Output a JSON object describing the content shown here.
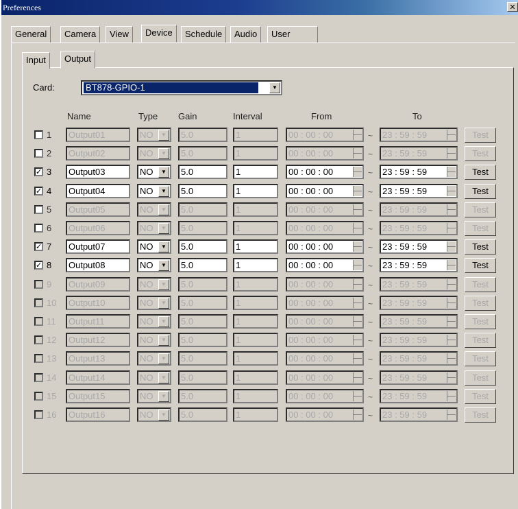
{
  "window": {
    "title": "Preferences",
    "close_glyph": "✕"
  },
  "tabs": [
    "General",
    "Camera",
    "View",
    "Device",
    "Schedule",
    "Audio",
    "User"
  ],
  "active_tab": "Device",
  "subtabs": [
    "Input",
    "Output"
  ],
  "active_subtab": "Output",
  "card": {
    "label": "Card:",
    "value": "BT878-GPIO-1"
  },
  "headers": {
    "name": "Name",
    "type": "Type",
    "gain": "Gain",
    "interval": "Interval",
    "from": "From",
    "to": "To"
  },
  "separator": "~",
  "check_glyph": "✓",
  "dropdown_icon": "▼",
  "rows": [
    {
      "num": "1",
      "checked": false,
      "enabled": false,
      "name": "Output01",
      "type": "NO",
      "gain": "5.0",
      "interval": "1",
      "from": "00 : 00 : 00",
      "to": "23 : 59 : 59",
      "test": "Test",
      "grey_num": false
    },
    {
      "num": "2",
      "checked": false,
      "enabled": false,
      "name": "Output02",
      "type": "NO",
      "gain": "5.0",
      "interval": "1",
      "from": "00 : 00 : 00",
      "to": "23 : 59 : 59",
      "test": "Test",
      "grey_num": false
    },
    {
      "num": "3",
      "checked": true,
      "enabled": true,
      "name": "Output03",
      "type": "NO",
      "gain": "5.0",
      "interval": "1",
      "from": "00 : 00 : 00",
      "to": "23 : 59 : 59",
      "test": "Test",
      "grey_num": false
    },
    {
      "num": "4",
      "checked": true,
      "enabled": true,
      "name": "Output04",
      "type": "NO",
      "gain": "5.0",
      "interval": "1",
      "from": "00 : 00 : 00",
      "to": "23 : 59 : 59",
      "test": "Test",
      "grey_num": false
    },
    {
      "num": "5",
      "checked": false,
      "enabled": false,
      "name": "Output05",
      "type": "NO",
      "gain": "5.0",
      "interval": "1",
      "from": "00 : 00 : 00",
      "to": "23 : 59 : 59",
      "test": "Test",
      "grey_num": false
    },
    {
      "num": "6",
      "checked": false,
      "enabled": false,
      "name": "Output06",
      "type": "NO",
      "gain": "5.0",
      "interval": "1",
      "from": "00 : 00 : 00",
      "to": "23 : 59 : 59",
      "test": "Test",
      "grey_num": false
    },
    {
      "num": "7",
      "checked": true,
      "enabled": true,
      "name": "Output07",
      "type": "NO",
      "gain": "5.0",
      "interval": "1",
      "from": "00 : 00 : 00",
      "to": "23 : 59 : 59",
      "test": "Test",
      "grey_num": false
    },
    {
      "num": "8",
      "checked": true,
      "enabled": true,
      "name": "Output08",
      "type": "NO",
      "gain": "5.0",
      "interval": "1",
      "from": "00 : 00 : 00",
      "to": "23 : 59 : 59",
      "test": "Test",
      "grey_num": false
    },
    {
      "num": "9",
      "checked": false,
      "enabled": false,
      "name": "Output09",
      "type": "NO",
      "gain": "5.0",
      "interval": "1",
      "from": "00 : 00 : 00",
      "to": "23 : 59 : 59",
      "test": "Test",
      "grey_num": true
    },
    {
      "num": "10",
      "checked": false,
      "enabled": false,
      "name": "Output10",
      "type": "NO",
      "gain": "5.0",
      "interval": "1",
      "from": "00 : 00 : 00",
      "to": "23 : 59 : 59",
      "test": "Test",
      "grey_num": true
    },
    {
      "num": "11",
      "checked": false,
      "enabled": false,
      "name": "Output11",
      "type": "NO",
      "gain": "5.0",
      "interval": "1",
      "from": "00 : 00 : 00",
      "to": "23 : 59 : 59",
      "test": "Test",
      "grey_num": true
    },
    {
      "num": "12",
      "checked": false,
      "enabled": false,
      "name": "Output12",
      "type": "NO",
      "gain": "5.0",
      "interval": "1",
      "from": "00 : 00 : 00",
      "to": "23 : 59 : 59",
      "test": "Test",
      "grey_num": true
    },
    {
      "num": "13",
      "checked": false,
      "enabled": false,
      "name": "Output13",
      "type": "NO",
      "gain": "5.0",
      "interval": "1",
      "from": "00 : 00 : 00",
      "to": "23 : 59 : 59",
      "test": "Test",
      "grey_num": true
    },
    {
      "num": "14",
      "checked": false,
      "enabled": false,
      "name": "Output14",
      "type": "NO",
      "gain": "5.0",
      "interval": "1",
      "from": "00 : 00 : 00",
      "to": "23 : 59 : 59",
      "test": "Test",
      "grey_num": true
    },
    {
      "num": "15",
      "checked": false,
      "enabled": false,
      "name": "Output15",
      "type": "NO",
      "gain": "5.0",
      "interval": "1",
      "from": "00 : 00 : 00",
      "to": "23 : 59 : 59",
      "test": "Test",
      "grey_num": true
    },
    {
      "num": "16",
      "checked": false,
      "enabled": false,
      "name": "Output16",
      "type": "NO",
      "gain": "5.0",
      "interval": "1",
      "from": "00 : 00 : 00",
      "to": "23 : 59 : 59",
      "test": "Test",
      "grey_num": true
    }
  ]
}
